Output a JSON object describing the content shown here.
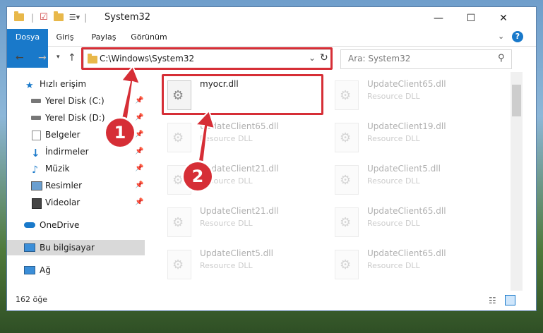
{
  "window": {
    "title": "System32"
  },
  "ribbon": {
    "tabs": [
      "Dosya",
      "Giriş",
      "Paylaş",
      "Görünüm"
    ]
  },
  "address": {
    "path": "C:\\Windows\\System32"
  },
  "search": {
    "placeholder": "Ara: System32"
  },
  "nav": {
    "items": [
      {
        "label": "Hızlı erişim"
      },
      {
        "label": "Yerel Disk (C:)"
      },
      {
        "label": "Yerel Disk (D:)"
      },
      {
        "label": "Belgeler"
      },
      {
        "label": "İndirmeler"
      },
      {
        "label": "Müzik"
      },
      {
        "label": "Resimler"
      },
      {
        "label": "Videolar"
      },
      {
        "label": "OneDrive"
      },
      {
        "label": "Bu bilgisayar"
      },
      {
        "label": "Ağ"
      }
    ]
  },
  "files": {
    "main": {
      "name": "myocr.dll",
      "type": ""
    },
    "left": [
      {
        "name": "UpdateClient65.dll",
        "type": "Resource DLL"
      },
      {
        "name": "UpdateClient21.dll",
        "type": "Resource DLL"
      },
      {
        "name": "UpdateClient21.dll",
        "type": "Resource DLL"
      },
      {
        "name": "UpdateClient5.dll",
        "type": "Resource DLL"
      }
    ],
    "right": [
      {
        "name": "UpdateClient65.dll",
        "type": "Resource DLL"
      },
      {
        "name": "UpdateClient19.dll",
        "type": "Resource DLL"
      },
      {
        "name": "UpdateClient5.dll",
        "type": "Resource DLL"
      },
      {
        "name": "UpdateClient65.dll",
        "type": "Resource DLL"
      },
      {
        "name": "UpdateClient65.dll",
        "type": "Resource DLL"
      }
    ]
  },
  "status": {
    "count": "162 öğe"
  },
  "annotations": {
    "step1": "1",
    "step2": "2"
  },
  "colors": {
    "accent": "#1979ca",
    "highlight": "#d62e36"
  }
}
